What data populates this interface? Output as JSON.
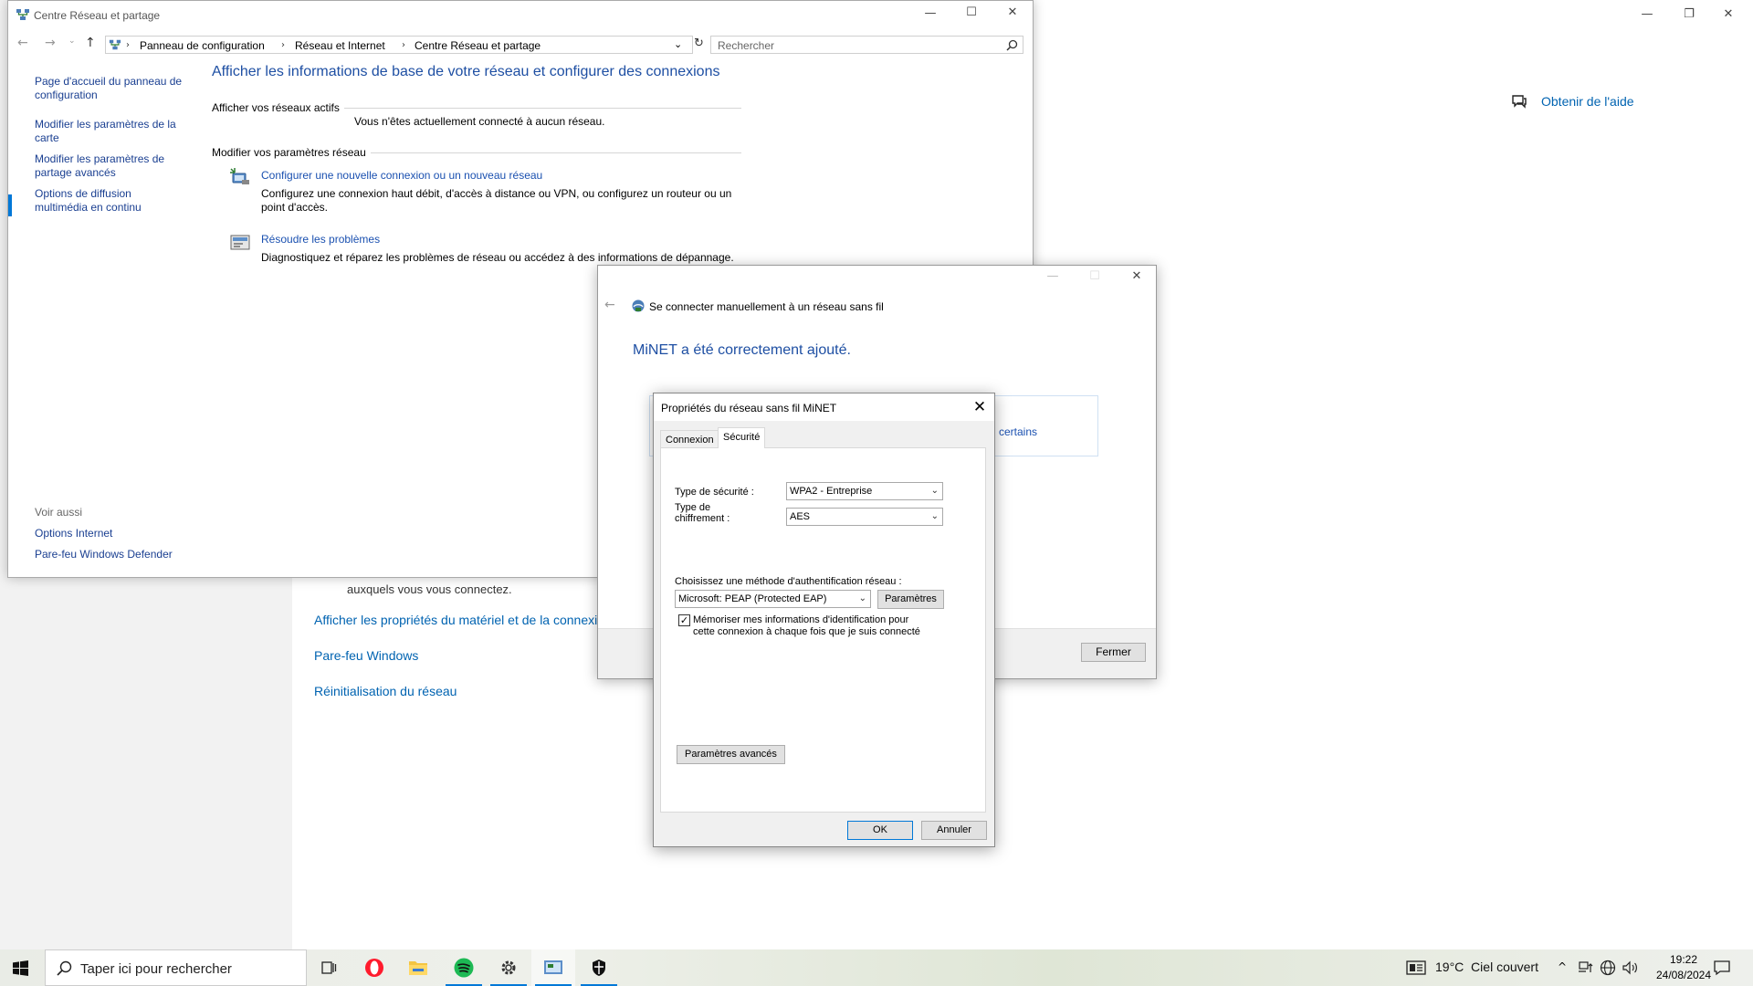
{
  "settings_window": {
    "help_label": "Obtenir de l'aide",
    "partial_text": "auxquels vous vous connectez.",
    "links": [
      "Afficher les propriétés du matériel et de la connexi",
      "Pare-feu Windows",
      "Réinitialisation du réseau"
    ],
    "minimize_icon": "—",
    "restore_icon": "❐",
    "close_icon": "✕"
  },
  "control_panel": {
    "title": "Centre Réseau et partage",
    "breadcrumbs": [
      "Panneau de configuration",
      "Réseau et Internet",
      "Centre Réseau et partage"
    ],
    "search_placeholder": "Rechercher",
    "left_links": [
      "Page d'accueil du panneau de configuration",
      "Modifier les paramètres de la carte",
      "Modifier les paramètres de partage avancés",
      "Options de diffusion multimédia en continu"
    ],
    "see_also_label": "Voir aussi",
    "see_also_links": [
      "Options Internet",
      "Pare-feu Windows Defender"
    ],
    "heading": "Afficher les informations de base de votre réseau et configurer des connexions",
    "active_networks_label": "Afficher vos réseaux actifs",
    "no_network_text": "Vous n'êtes actuellement connecté à aucun réseau.",
    "change_settings_label": "Modifier vos paramètres réseau",
    "tasks": [
      {
        "title": "Configurer une nouvelle connexion ou un nouveau réseau",
        "desc1": "Configurez une connexion haut débit, d'accès à distance ou VPN, ou configurez un routeur ou un",
        "desc2": "point d'accès."
      },
      {
        "title": "Résoudre les problèmes",
        "desc1": "Diagnostiquez et réparez les problèmes de réseau ou accédez à des informations de dépannage.",
        "desc2": ""
      }
    ]
  },
  "wizard": {
    "title": "Se connecter manuellement à un réseau sans fil",
    "heading": "MiNET a été correctement ajouté.",
    "partial_link": "certains",
    "close_button": "Fermer"
  },
  "properties_dialog": {
    "title": "Propriétés du réseau sans fil MiNET",
    "tabs": [
      "Connexion",
      "Sécurité"
    ],
    "security_type_label": "Type de sécurité :",
    "security_type_value": "WPA2 - Entreprise",
    "encryption_label_line1": "Type de",
    "encryption_label_line2": "chiffrement :",
    "encryption_value": "AES",
    "auth_method_label": "Choisissez une méthode d'authentification réseau :",
    "auth_method_value": "Microsoft: PEAP (Protected EAP)",
    "settings_button": "Paramètres",
    "remember_line1": "Mémoriser mes informations d'identification pour",
    "remember_line2": "cette connexion à chaque fois que je suis connecté",
    "remember_checked": true,
    "advanced_button": "Paramètres avancés",
    "ok_button": "OK",
    "cancel_button": "Annuler"
  },
  "taskbar": {
    "search_placeholder": "Taper ici pour rechercher",
    "weather": "19°C  Ciel couvert",
    "time": "19:22",
    "date": "24/08/2024",
    "accent_color": "#0078d7"
  }
}
